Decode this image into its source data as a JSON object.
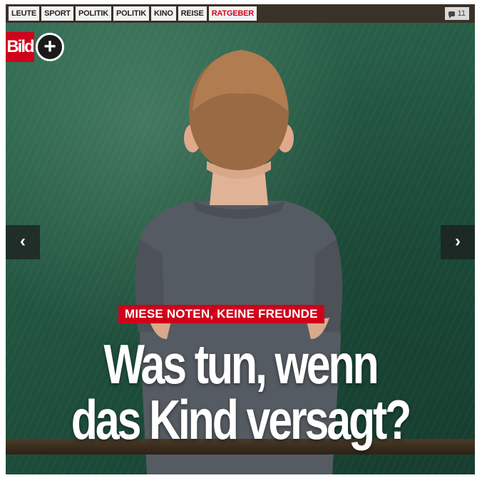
{
  "nav": {
    "tabs": [
      {
        "label": "LEUTE"
      },
      {
        "label": "SPORT"
      },
      {
        "label": "POLITIK"
      },
      {
        "label": "POLITIK"
      },
      {
        "label": "KINO"
      },
      {
        "label": "REISE"
      },
      {
        "label": "RATGEBER",
        "active": true
      }
    ],
    "comment_count": "11",
    "comment_icon": "comment-bubble-icon"
  },
  "brand": {
    "logo_text": "Bild",
    "plus_symbol": "+",
    "accent_color": "#d0021b"
  },
  "carousel": {
    "prev_symbol": "‹",
    "next_symbol": "›"
  },
  "article": {
    "kicker": "MIESE NOTEN, KEINE FREUNDE",
    "headline_line1": "Was tun, wenn",
    "headline_line2": "das Kind versagt?"
  }
}
